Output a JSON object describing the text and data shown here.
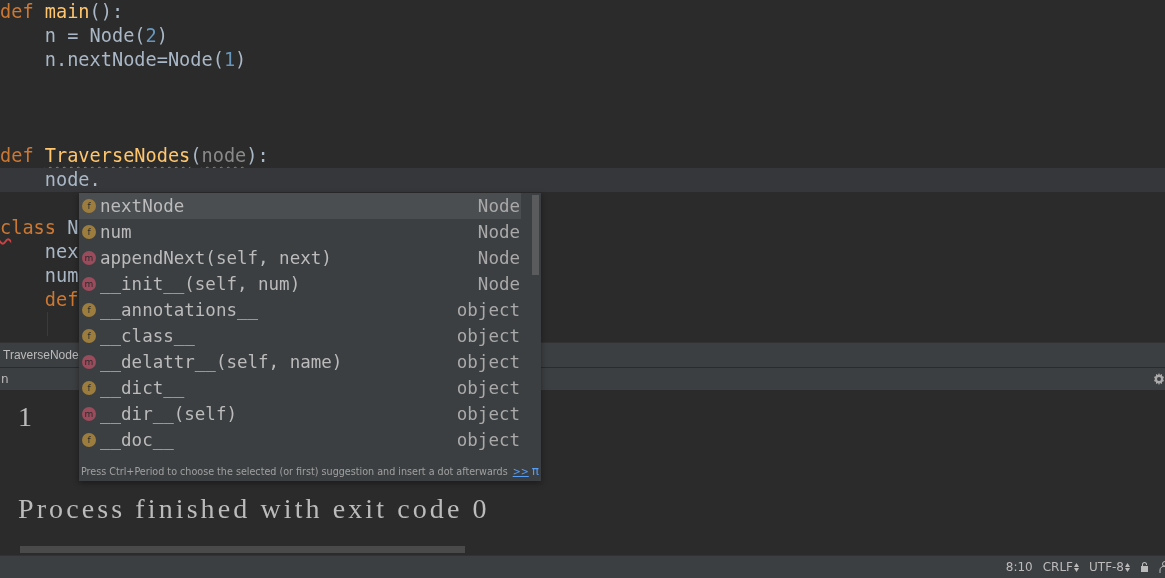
{
  "editor": {
    "lines": [
      {
        "kind": "code",
        "current": false,
        "tokens": [
          {
            "kind": "keyword",
            "text": "def "
          },
          {
            "kind": "function",
            "text": "main"
          },
          {
            "kind": "plain",
            "text": "():"
          }
        ]
      },
      {
        "kind": "code",
        "current": false,
        "tokens": [
          {
            "kind": "plain",
            "text": "    n = Node("
          },
          {
            "kind": "number",
            "text": "2"
          },
          {
            "kind": "plain",
            "text": ")"
          }
        ]
      },
      {
        "kind": "code",
        "current": false,
        "tokens": [
          {
            "kind": "plain",
            "text": "    n.nextNode=Node("
          },
          {
            "kind": "number",
            "text": "1"
          },
          {
            "kind": "plain",
            "text": ")"
          }
        ]
      },
      {
        "kind": "blank"
      },
      {
        "kind": "blank"
      },
      {
        "kind": "blank"
      },
      {
        "kind": "code",
        "current": false,
        "tokens": [
          {
            "kind": "keyword",
            "text": "def "
          },
          {
            "kind": "function",
            "text": "TraverseNodes",
            "warning": true
          },
          {
            "kind": "plain",
            "text": "("
          },
          {
            "kind": "param",
            "text": "node",
            "warning": true
          },
          {
            "kind": "plain",
            "text": "):"
          }
        ]
      },
      {
        "kind": "code",
        "current": true,
        "tokens": [
          {
            "kind": "plain",
            "text": "    node."
          }
        ]
      },
      {
        "kind": "blank"
      },
      {
        "kind": "code",
        "current": false,
        "tokens": [
          {
            "kind": "keyword",
            "text": "c",
            "error": true
          },
          {
            "kind": "keyword",
            "text": "lass "
          },
          {
            "kind": "plain",
            "text": "N"
          }
        ]
      },
      {
        "kind": "code",
        "current": false,
        "tokens": [
          {
            "kind": "plain",
            "text": "    nex"
          }
        ]
      },
      {
        "kind": "code",
        "current": false,
        "tokens": [
          {
            "kind": "plain",
            "text": "    num"
          }
        ]
      },
      {
        "kind": "code",
        "current": false,
        "tokens": [
          {
            "kind": "keyword",
            "text": "    def"
          }
        ]
      },
      {
        "kind": "blank",
        "indent_guide": true
      }
    ]
  },
  "breadcrumb": {
    "label": "TraverseNode"
  },
  "run_panel": {
    "tab_label": "n",
    "output": [
      "1",
      "Process finished with exit code 0"
    ]
  },
  "completion_popup": {
    "items": [
      {
        "kind": "field",
        "badge": "f",
        "name": "nextNode",
        "type": "Node",
        "selected": true
      },
      {
        "kind": "field",
        "badge": "f",
        "name": "num",
        "type": "Node",
        "selected": false
      },
      {
        "kind": "method",
        "badge": "m",
        "name": "appendNext(self, next)",
        "type": "Node",
        "selected": false
      },
      {
        "kind": "method",
        "badge": "m",
        "name": "__init__(self, num)",
        "type": "Node",
        "selected": false
      },
      {
        "kind": "field",
        "badge": "f",
        "name": "__annotations__",
        "type": "object",
        "selected": false
      },
      {
        "kind": "field",
        "badge": "f",
        "name": "__class__",
        "type": "object",
        "selected": false
      },
      {
        "kind": "method",
        "badge": "m",
        "name": "__delattr__(self, name)",
        "type": "object",
        "selected": false
      },
      {
        "kind": "field",
        "badge": "f",
        "name": "__dict__",
        "type": "object",
        "selected": false
      },
      {
        "kind": "method",
        "badge": "m",
        "name": "__dir__(self)",
        "type": "object",
        "selected": false
      },
      {
        "kind": "field",
        "badge": "f",
        "name": "__doc__",
        "type": "object",
        "selected": false
      }
    ],
    "hint": "Press Ctrl+Period to choose the selected (or first) suggestion and insert a dot afterwards",
    "hint_link": ">>",
    "hint_symbol": "π"
  },
  "status_bar": {
    "position": "8:10",
    "line_separator": "CRLF",
    "encoding": "UTF-8"
  }
}
